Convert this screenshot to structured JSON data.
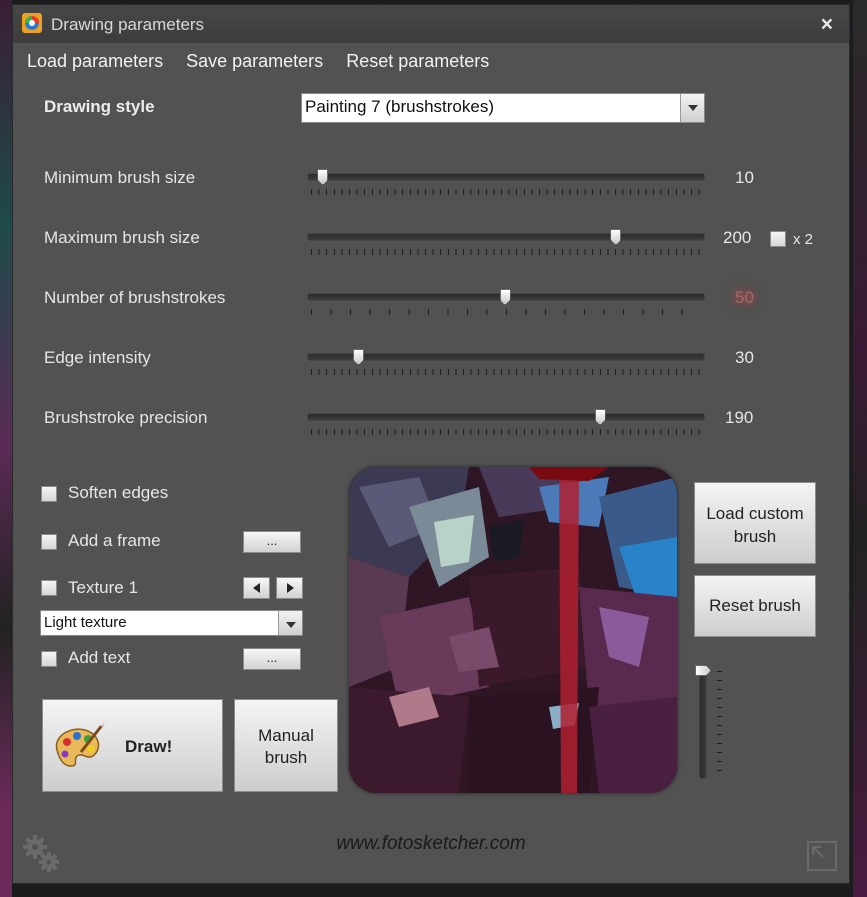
{
  "window": {
    "title": "Drawing parameters",
    "close_label": "×"
  },
  "menu": {
    "load": "Load parameters",
    "save": "Save parameters",
    "reset": "Reset parameters"
  },
  "drawing_style": {
    "label": "Drawing style",
    "value": "Painting 7 (brushstrokes)"
  },
  "sliders": [
    {
      "label": "Minimum brush size",
      "value": "10",
      "fraction": 0.04
    },
    {
      "label": "Maximum brush size",
      "value": "200",
      "fraction": 0.78
    },
    {
      "label": "Number of brushstrokes",
      "value": "50",
      "fraction": 0.5
    },
    {
      "label": "Edge intensity",
      "value": "30",
      "fraction": 0.13
    },
    {
      "label": "Brushstroke precision",
      "value": "190",
      "fraction": 0.74
    }
  ],
  "max_brush_x2": {
    "label": "x 2",
    "checked": false
  },
  "options": {
    "soften_edges": "Soften edges",
    "add_frame": "Add a frame",
    "texture": "Texture 1",
    "texture_value": "Light texture",
    "add_text": "Add text",
    "ellipsis": "..."
  },
  "buttons": {
    "draw": "Draw!",
    "manual_brush_line1": "Manual",
    "manual_brush_line2": "brush",
    "load_custom_brush_line1": "Load custom",
    "load_custom_brush_line2": "brush",
    "reset_brush": "Reset brush"
  },
  "footer": {
    "url": "www.fotosketcher.com"
  },
  "colors": {
    "window_bg": "#525252",
    "titlebar": "#424242",
    "text": "#e6e6e6",
    "glow_value": "#c24a4a"
  }
}
